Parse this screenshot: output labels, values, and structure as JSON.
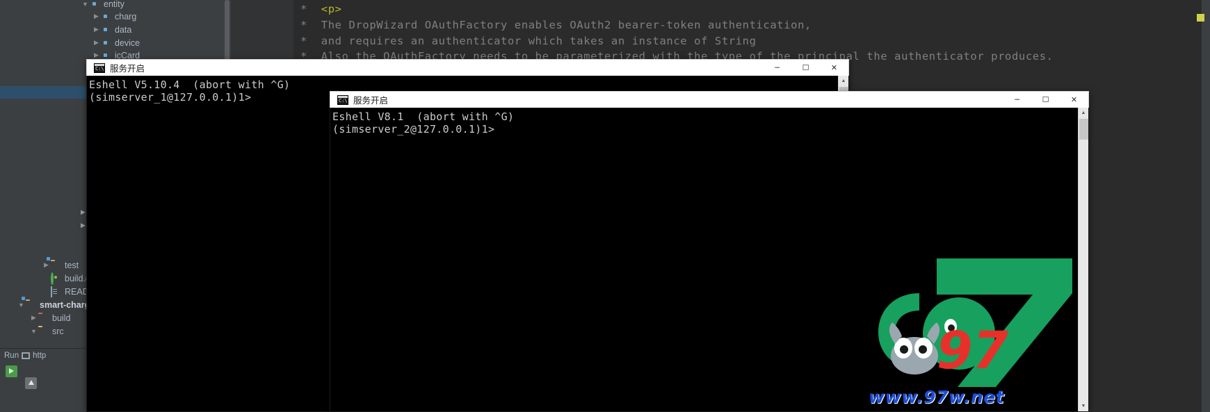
{
  "ide": {
    "sidebar": {
      "tree": [
        {
          "label": "entity",
          "indent": 0,
          "arrow": "down",
          "icon": "package-icon",
          "bold": false
        },
        {
          "label": "charg",
          "indent": 1,
          "arrow": "right",
          "icon": "package-icon",
          "bold": false
        },
        {
          "label": "data",
          "indent": 1,
          "arrow": "right",
          "icon": "package-icon",
          "bold": false
        },
        {
          "label": "device",
          "indent": 1,
          "arrow": "right",
          "icon": "package-icon",
          "bold": false
        },
        {
          "label": "icCard",
          "indent": 1,
          "arrow": "right",
          "icon": "package-icon",
          "bold": false
        },
        {
          "label": "test",
          "indent": 0,
          "arrow": "right",
          "icon": "folder-source-icon",
          "bold": false
        },
        {
          "label": "build.gra",
          "indent": 0,
          "arrow": "none",
          "icon": "gradle-icon",
          "bold": false
        },
        {
          "label": "README",
          "indent": 0,
          "arrow": "none",
          "icon": "document-icon",
          "bold": false
        },
        {
          "label": "smart-charg",
          "indent": -1,
          "arrow": "down",
          "icon": "module-icon",
          "bold": true
        },
        {
          "label": "build",
          "indent": 0,
          "arrow": "right",
          "icon": "folder-red-icon",
          "bold": false
        },
        {
          "label": "src",
          "indent": 0,
          "arrow": "down",
          "icon": "folder-plain-icon",
          "bold": false
        }
      ]
    },
    "statusbar": {
      "run_label": "Run",
      "http_label": "http",
      "run_icon": "run-icon",
      "rerun_button": "rerun-button",
      "up_button": "scroll-up-button"
    },
    "editor": {
      "code_lines": [
        {
          "prefix": "*",
          "text": "<p>",
          "kind": "tag"
        },
        {
          "prefix": "*",
          "text": "The DropWizard OAuthFactory enables OAuth2 bearer-token authentication,",
          "kind": "comment"
        },
        {
          "prefix": "*",
          "text": "and requires an authenticator which takes an instance of String",
          "kind": "comment"
        },
        {
          "prefix": "*",
          "text": "Also the OAuthFactory needs to be parameterized with the type of the principal the authenticator produces.",
          "kind": "comment"
        }
      ]
    }
  },
  "windows": [
    {
      "title": "服务开启",
      "icon": "console-icon",
      "minimize": "─",
      "maximize": "☐",
      "close": "✕",
      "lines": [
        "Eshell V5.10.4  (abort with ^G)",
        "(simserver_1@127.0.0.1)1>"
      ]
    },
    {
      "title": "服务开启",
      "icon": "console-icon",
      "minimize": "─",
      "maximize": "☐",
      "close": "✕",
      "lines": [
        "Eshell V8.1  (abort with ^G)",
        "(simserver_2@127.0.0.1)1>"
      ]
    }
  ],
  "watermark": {
    "url": "www.97w.net",
    "logo_text": "97",
    "colors": {
      "green": "#17a05e",
      "url_blue": "#1b4fd8"
    }
  }
}
